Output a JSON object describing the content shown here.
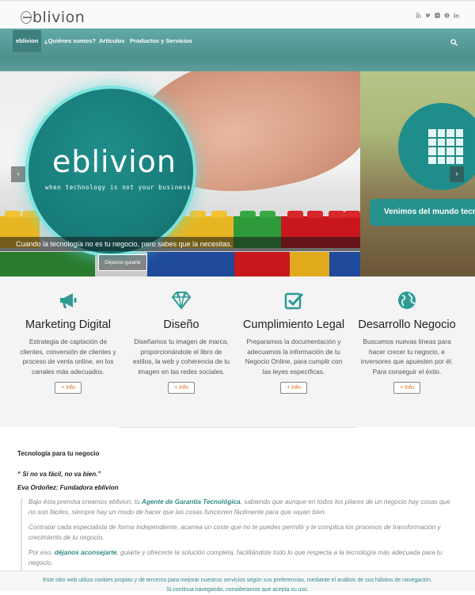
{
  "header": {
    "logo_text": "blivion",
    "social_icons": [
      "rss-icon",
      "twitter-icon",
      "youtube-icon",
      "skype-icon",
      "linkedin-icon"
    ]
  },
  "nav": {
    "items": [
      {
        "label": "eblivion",
        "active": true
      },
      {
        "label": "¿Quiénes somos?",
        "active": false
      },
      {
        "label": "Artículos",
        "active": false
      },
      {
        "label": "Productos y Servicios",
        "active": false
      }
    ],
    "search_icon": "search-icon"
  },
  "hero": {
    "brand": "eblivion",
    "tagline": "when technology is not your business",
    "caption": "Cuando la tecnología no es tu negocio, pero sabes que la necesitas.",
    "button": "Déjanos guiarte",
    "next_slide_text": "Venimos del mundo tecn"
  },
  "services": [
    {
      "icon": "megaphone-icon",
      "title": "Marketing Digital",
      "text": "Estrategia de captación de clientes, conversión de clientes y proceso de venta online, en los canales más adecuados.",
      "button": "+ Info"
    },
    {
      "icon": "diamond-icon",
      "title": "Diseño",
      "text": "Diseñamos tu imagen de marca, proporcionándote el libro de estilos, la web y coherencia de tu imagen en las redes sociales.",
      "button": "+ Info"
    },
    {
      "icon": "checkbox-icon",
      "title": "Cumplimiento Legal",
      "text": "Preparamos la documentación y adecuamos la información de tu Negocio Online, para cumplir con las leyes específicas.",
      "button": "+ Info"
    },
    {
      "icon": "globe-icon",
      "title": "Desarrollo Negocio",
      "text": "Buscamos nuevas líneas para hacer crecer tu negocio, e inversores que apuesten por él. Para conseguir el éxito.",
      "button": "+ Info"
    }
  ],
  "article": {
    "heading": "Tecnología para tu negocio",
    "quote": "“ Si no va fácil, no va bien.”",
    "author": "Eva Ordoñez: Fundadora eblivion",
    "p1_a": "Bajo ésta premisa creamos eblivion, tu ",
    "p1_link": "Agente de Garantía Tecnológica",
    "p1_b": ", sabiendo que aunque en todos los pilares de un negocio hay cosas que no son fáciles, siempre hay un modo de hacer que las cosas funcionen fácilmente para que vayan bien.",
    "p2": "Contratar cada especialista de forma independiente, acarrea un coste que no te puedes permitir y te complica los procesos de transformación y crecimiento de tu negocio.",
    "p3_a": "Por eso, ",
    "p3_link": "déjanos aconsejarte",
    "p3_b": ", guiarte y ofrecerte la solución completa, facilitándote todo lo que respecta a la tecnología más adecuada para tu negocio."
  },
  "cookie": {
    "line1": "Este sitio web utiliza cookies propias y de terceros para mejorar nuestros servicios según sus preferencias, mediante el análisis de sus hábitos de navegación.",
    "line2": "Si continua navegando, consideramos que acepta su uso."
  }
}
